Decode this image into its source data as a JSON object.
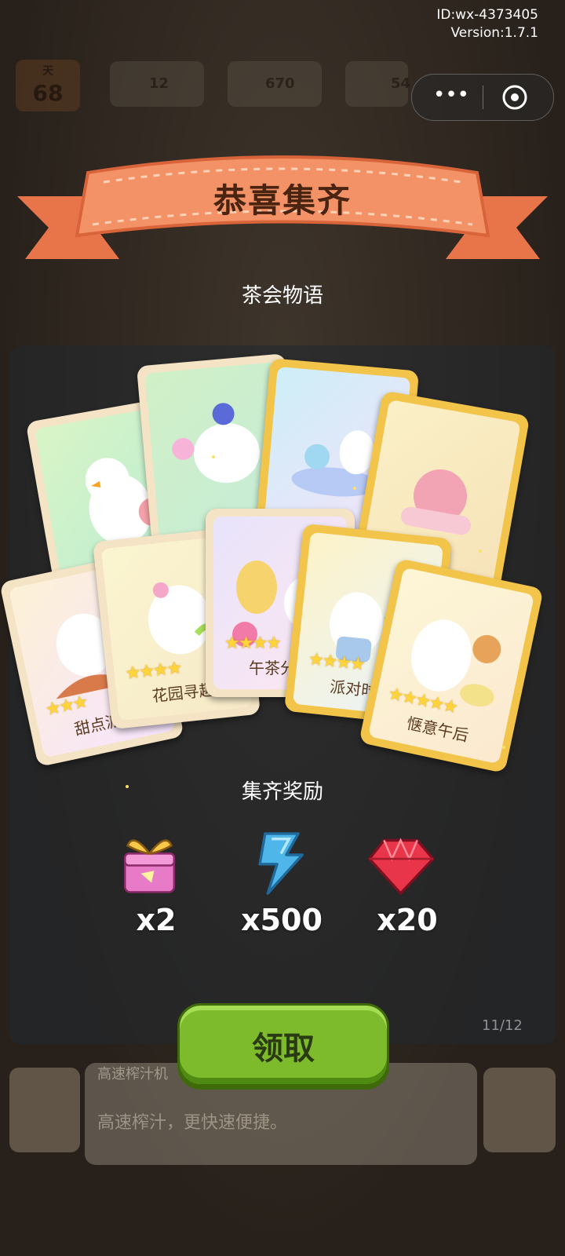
{
  "meta": {
    "id": "ID:wx-4373405",
    "version": "Version:1.7.1"
  },
  "hud": {
    "day_label": "天",
    "day": "68",
    "energy": "12",
    "coins": "670",
    "gems": "54"
  },
  "popup": {
    "title": "恭喜集齐",
    "collection_name": "茶会物语",
    "cards": [
      {
        "name": "",
        "stars": 0
      },
      {
        "name": "",
        "stars": 0
      },
      {
        "name": "",
        "stars": 0
      },
      {
        "name": "",
        "stars": 0
      },
      {
        "name": "甜点派对",
        "stars": 3
      },
      {
        "name": "花园寻趣",
        "stars": 4
      },
      {
        "name": "午茶分享",
        "stars": 4
      },
      {
        "name": "派对时光",
        "stars": 4
      },
      {
        "name": "惬意午后",
        "stars": 5
      }
    ],
    "rewards_label": "集齐奖励",
    "rewards": [
      {
        "icon": "gift-box-icon",
        "amount": "x2"
      },
      {
        "icon": "energy-bolt-icon",
        "amount": "x500"
      },
      {
        "icon": "ruby-gem-icon",
        "amount": "x20"
      }
    ],
    "claim_label": "领取"
  },
  "background": {
    "panel_title": "高速榨汁机",
    "panel_desc": "高速榨汁，更快速便捷。",
    "board_count": "11/12"
  },
  "colors": {
    "ribbon": "#f08a5a",
    "claim": "#7dbb2c",
    "gold_card": "#f2c44a"
  }
}
